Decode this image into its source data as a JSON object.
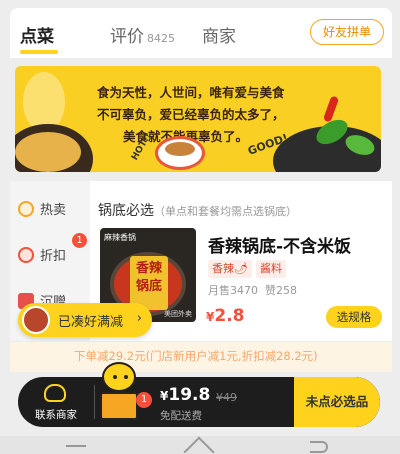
{
  "tabs": {
    "items": [
      {
        "label": "点菜",
        "count": ""
      },
      {
        "label": "评价",
        "count": "8425"
      },
      {
        "label": "商家",
        "count": ""
      }
    ],
    "group_button": "好友拼单"
  },
  "banner": {
    "lines": [
      "食为天性，人世间，唯有爱与美食",
      "不可辜负，爱已经辜负的太多了，",
      "美食就不能再辜负了。"
    ],
    "hot_text": "HOT!!",
    "good_text": "GOOD!"
  },
  "sidebar": {
    "items": [
      {
        "label": "热卖",
        "icon": "flame-icon",
        "color": "#f5a623"
      },
      {
        "label": "折扣",
        "icon": "discount-icon",
        "color": "#f5503a",
        "badge": "1"
      },
      {
        "label": "沉赠",
        "icon": "gift-icon",
        "color": "#e8504a"
      }
    ]
  },
  "section": {
    "title": "锅底必选",
    "note": "（单点和套餐均需点选锅底）"
  },
  "item": {
    "image_caption": "麻辣香锅",
    "image_sign": "香辣锅底",
    "image_brand": "美团外卖",
    "name": "香辣锅底-不含米饭",
    "tags": [
      "香辣🌶",
      "酱料"
    ],
    "monthly_sales": "月售3470",
    "likes": "赞258",
    "price_symbol": "¥",
    "price": "2.8",
    "spec_button": "选规格"
  },
  "pill": {
    "text": "已凑好满减",
    "arrow": "›"
  },
  "discount": {
    "text": "下单减29.2元(门店新用户减1元,折扣减28.2元)"
  },
  "cart": {
    "contact_label": "联系商家",
    "badge": "1",
    "currency": "¥",
    "total": "19.8",
    "original": "¥49",
    "delivery": "免配送费",
    "checkout": "未点必选品"
  },
  "colors": {
    "accent": "#ffd21e",
    "price_red": "#f5503a",
    "discount_orange": "#f07a1a"
  }
}
